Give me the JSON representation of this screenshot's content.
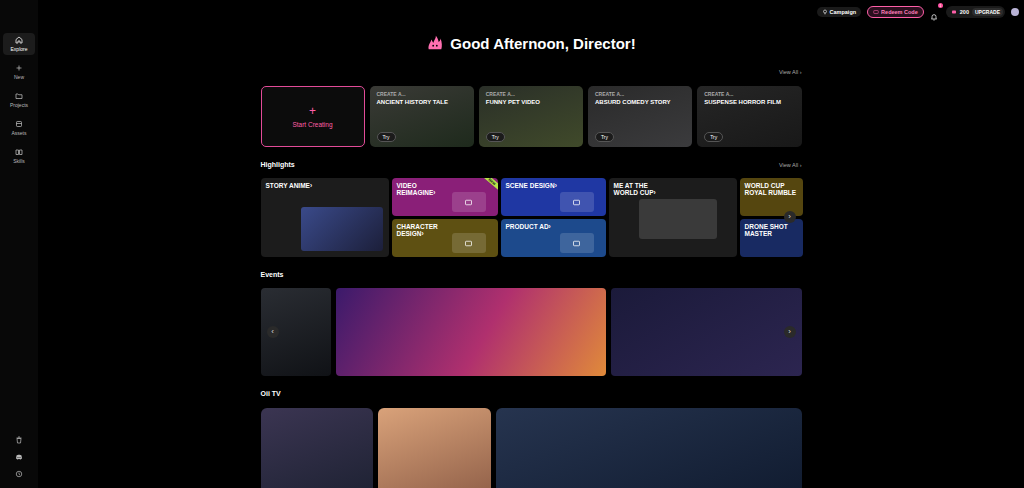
{
  "sidebar": {
    "items": [
      {
        "label": "Explore",
        "selected": true
      },
      {
        "label": "New",
        "selected": false
      },
      {
        "label": "Projects",
        "selected": false
      },
      {
        "label": "Assets",
        "selected": false
      },
      {
        "label": "Skills",
        "selected": false
      }
    ]
  },
  "topbar": {
    "campaign": "Campaign",
    "redeem": "Redeem Code",
    "notifications": "1",
    "credits": "200",
    "upgrade": "UPGRADE"
  },
  "greeting": "Good Afternoon, Director!",
  "create": {
    "view_all": "View All ›",
    "start": {
      "icon": "+",
      "label": "Start Creating"
    },
    "templates": [
      {
        "prefix": "CREATE A...",
        "title": "ANCIENT HISTORY TALE",
        "button": "Try"
      },
      {
        "prefix": "CREATE A...",
        "title": "FUNNY PET VIDEO",
        "button": "Try"
      },
      {
        "prefix": "CREATE A...",
        "title": "ABSURD COMEDY STORY",
        "button": "Try"
      },
      {
        "prefix": "CREATE A...",
        "title": "SUSPENSE HORROR FILM",
        "button": "Try"
      }
    ]
  },
  "highlights": {
    "title": "Highlights",
    "view_all": "View All ›",
    "next": "›",
    "items": [
      {
        "title": "STORY ANIME",
        "arrow": "›",
        "kind": "large",
        "color": "#1c1c1c"
      },
      {
        "title": "VIDEO REIMAGINE",
        "arrow": "›",
        "kind": "small",
        "color": "#8a1f78",
        "badge": "New"
      },
      {
        "title": "CHARACTER DESIGN",
        "arrow": "›",
        "kind": "small",
        "color": "#5e5012"
      },
      {
        "title": "SCENE DESIGN",
        "arrow": "›",
        "kind": "small",
        "color": "#1f37a3"
      },
      {
        "title": "PRODUCT AD",
        "arrow": "›",
        "kind": "small",
        "color": "#1d4a8c"
      },
      {
        "title": "ME AT THE WORLD CUP",
        "arrow": "›",
        "kind": "large",
        "color": "#1c1c1c"
      },
      {
        "title": "WORLD CUP ROYAL RUMBLE",
        "arrow": "",
        "kind": "small",
        "color": "#55460f"
      },
      {
        "title": "DRONE SHOT MASTER",
        "arrow": "",
        "kind": "small",
        "color": "#182a62"
      }
    ]
  },
  "events": {
    "title": "Events",
    "prev": "‹",
    "next": "›"
  },
  "tv": {
    "title": "Oii TV"
  }
}
